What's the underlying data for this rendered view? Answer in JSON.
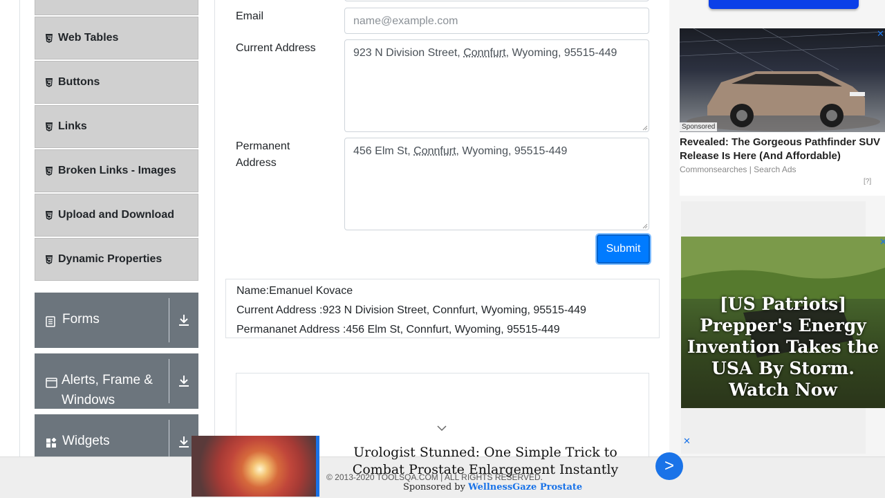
{
  "sidebar": {
    "items": [
      {
        "label": ""
      },
      {
        "label": "Web Tables"
      },
      {
        "label": "Buttons"
      },
      {
        "label": "Links"
      },
      {
        "label": "Broken Links - Images"
      },
      {
        "label": "Upload and Download"
      },
      {
        "label": "Dynamic Properties"
      }
    ],
    "groups": [
      {
        "label": "Forms",
        "icon": "list-icon"
      },
      {
        "label": "Alerts, Frame & Windows",
        "icon": "window-icon"
      },
      {
        "label": "Widgets",
        "icon": "widgets-icon"
      }
    ]
  },
  "form": {
    "email_label": "Email",
    "email_placeholder": "name@example.com",
    "current_address_label": "Current Address",
    "current_address_parts": [
      "923 N Division Street, ",
      "Connfurt",
      ", Wyoming, 95515-449"
    ],
    "permanent_address_label": "Permanent Address",
    "permanent_address_parts": [
      "456 Elm St, ",
      "Connfurt",
      ", Wyoming, 95515-449"
    ],
    "submit_label": "Submit"
  },
  "output": {
    "name": "Name:Emanuel Kovace",
    "current_address": "Current Address :923 N Division Street, Connfurt, Wyoming, 95515-449",
    "permanent_address": "Permananet Address :456 Elm St, Connfurt, Wyoming, 95515-449"
  },
  "ads": {
    "sponsored_label": "Sponsored",
    "ad1_title": "Revealed: The Gorgeous Pathfinder SUV Release Is Here (And Affordable)",
    "ad1_source": "Commonsearches | Search Ads",
    "ad1_info": "[?]",
    "ad2_text": "[US Patriots] Prepper's Energy Invention Takes the USA By Storm. Watch Now",
    "ad3_title": "Urologist Stunned: One Simple Trick to Combat Prostate Enlargement Instantly",
    "ad3_sponsored_prefix": "Sponsored by ",
    "ad3_sponsor": "WellnessGaze Prostate",
    "ad3_arrow": ">",
    "close": "✕"
  },
  "footer": {
    "copyright": "© 2013-2020 TOOLSQA.COM | ALL RIGHTS RESERVED."
  },
  "colors": {
    "primary": "#007bff",
    "sidebar_group": "#6c757d",
    "sidebar_item": "#d0d0d0",
    "ad_link": "#1a73e8"
  }
}
